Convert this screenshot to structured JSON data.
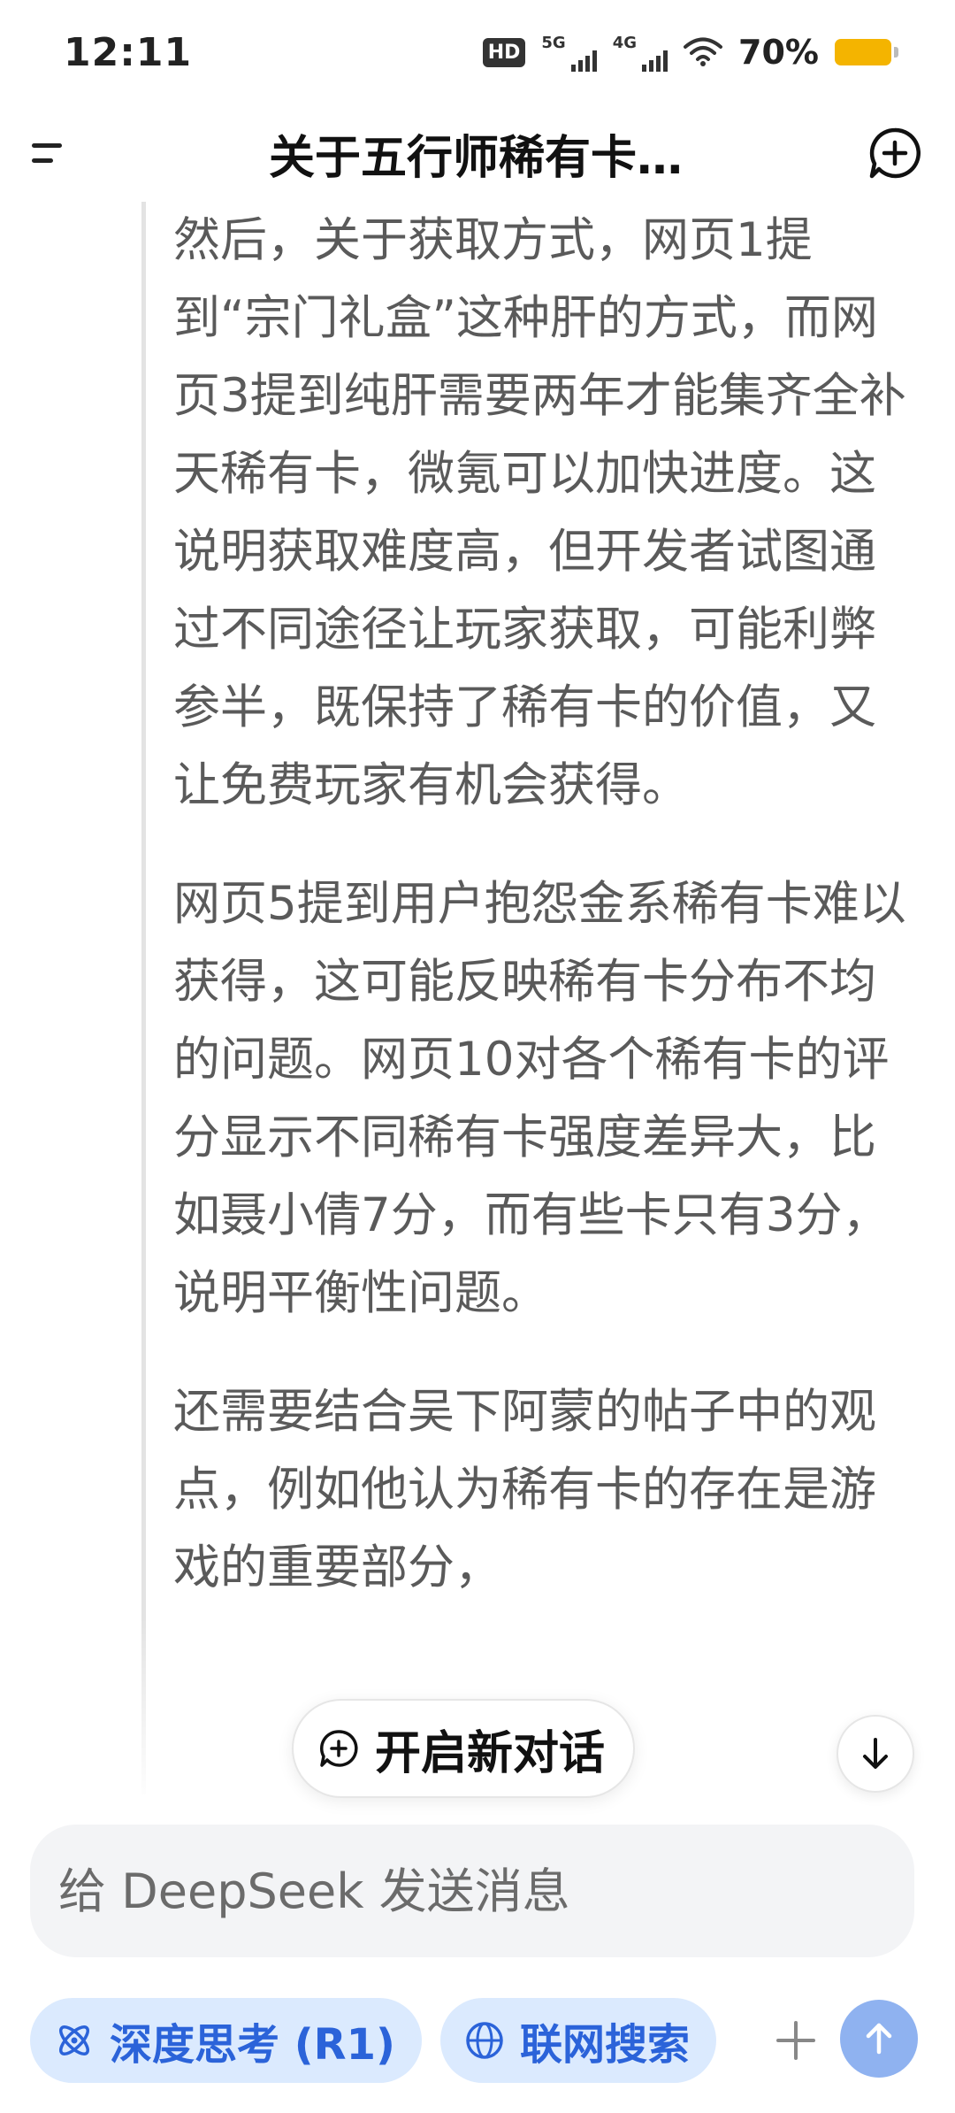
{
  "status_bar": {
    "time": "12:11",
    "hd_label": "HD",
    "net1": "5G",
    "net2": "4G",
    "battery": "70%",
    "battery_color": "#f4b400"
  },
  "header": {
    "title": "关于五行师稀有卡…",
    "menu_icon": "menu-icon",
    "new_chat_icon": "chat-plus-icon"
  },
  "thought": {
    "paragraphs": [
      "然后，关于获取方式，网页1提到“宗门礼盒”这种肝的方式，而网页3提到纯肝需要两年才能集齐全补天稀有卡，微氪可以加快进度。这说明获取难度高，但开发者试图通过不同途径让玩家获取，可能利弊参半，既保持了稀有卡的价值，又让免费玩家有机会获得。",
      "网页5提到用户抱怨金系稀有卡难以获得，这可能反映稀有卡分布不均的问题。网页10对各个稀有卡的评分显示不同稀有卡强度差异大，比如聂小倩7分，而有些卡只有3分，说明平衡性问题。",
      "还需要结合吴下阿蒙的帖子中的观点，例如他认为稀有卡的存在是游戏的重要部分，"
    ]
  },
  "floating": {
    "new_chat_label": "开启新对话",
    "scroll_icon": "arrow-down-icon"
  },
  "input": {
    "placeholder": "给 DeepSeek 发送消息"
  },
  "toolbar": {
    "deep_think_label": "深度思考 (R1)",
    "web_search_label": "联网搜索",
    "accent_color": "#2b63d9",
    "chip_bg": "#dbeafe",
    "send_bg": "#8fb2f0"
  }
}
